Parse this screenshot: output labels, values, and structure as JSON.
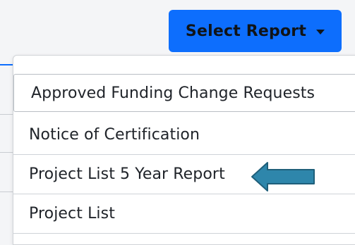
{
  "toolbar": {
    "select_report_label": "Select Report",
    "button_color": "#0d6efd"
  },
  "dropdown": {
    "items": [
      {
        "label": "Approved Funding Change Requests"
      },
      {
        "label": "Notice of Certification"
      },
      {
        "label": "Project List 5 Year Report"
      },
      {
        "label": "Project List"
      }
    ]
  },
  "callout": {
    "icon": "left-arrow-icon",
    "color": "#2e86ab"
  }
}
